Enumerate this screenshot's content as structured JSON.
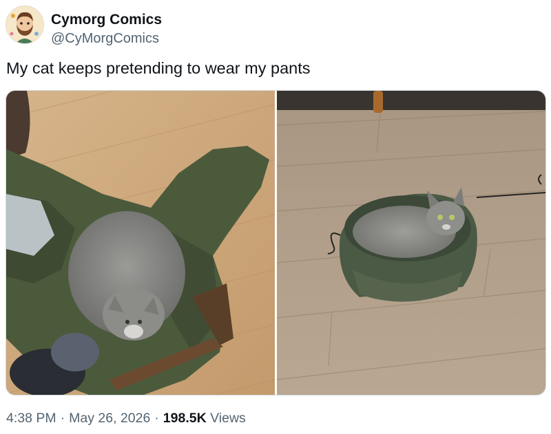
{
  "author": {
    "display_name": "Cymorg Comics",
    "handle": "@CyMorgComics",
    "avatar_icon": "cartoon-bearded-man-avatar"
  },
  "tweet": {
    "text": "My cat keeps pretending to wear my pants",
    "time": "4:38 PM",
    "separator": "·",
    "date": "May 26, 2026",
    "views_count": "198.5K",
    "views_label": "Views"
  },
  "media": {
    "photos": [
      {
        "subject": "gray cat lying on green jacket on wooden floor"
      },
      {
        "subject": "gray cat curled up inside green pants on wooden floor"
      }
    ]
  },
  "colors": {
    "text_primary": "#0f1419",
    "text_secondary": "#536471",
    "wood_floor": "#c9a77c",
    "fabric_green": "#4c5a3c",
    "cat_gray": "#8a8a88"
  }
}
